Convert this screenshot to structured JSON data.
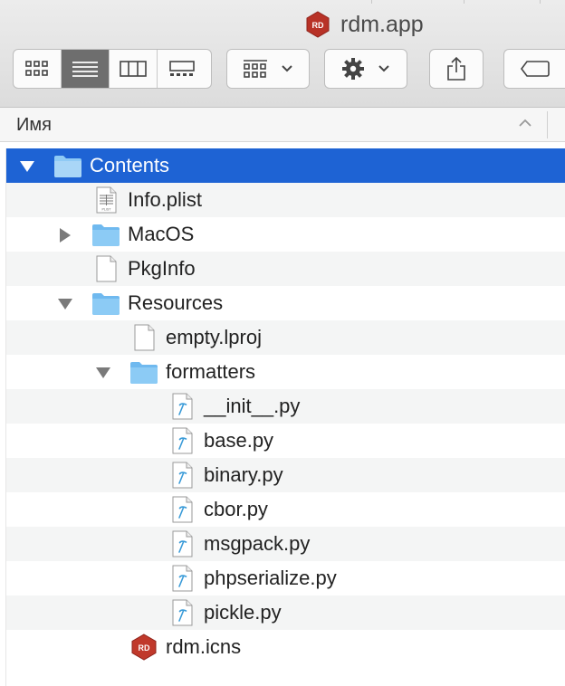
{
  "window": {
    "title": "rdm.app"
  },
  "toolbar": {
    "view_modes": [
      "icon-view",
      "list-view",
      "column-view",
      "gallery-view"
    ],
    "active_view": "list-view"
  },
  "column_header": {
    "name": "Имя"
  },
  "colors": {
    "selection": "#1e63d4",
    "folder": "#6fb9ef",
    "script_accent": "#3a9bd8",
    "app_icon": "#c0392b"
  },
  "files": [
    {
      "label": "Contents",
      "type": "folder",
      "depth": 0,
      "disclosure": "expanded",
      "selected": true
    },
    {
      "label": "Info.plist",
      "type": "plist",
      "depth": 1,
      "disclosure": "none",
      "selected": false
    },
    {
      "label": "MacOS",
      "type": "folder",
      "depth": 1,
      "disclosure": "collapsed",
      "selected": false
    },
    {
      "label": "PkgInfo",
      "type": "document",
      "depth": 1,
      "disclosure": "none",
      "selected": false
    },
    {
      "label": "Resources",
      "type": "folder",
      "depth": 1,
      "disclosure": "expanded",
      "selected": false
    },
    {
      "label": "empty.lproj",
      "type": "document",
      "depth": 2,
      "disclosure": "none",
      "selected": false
    },
    {
      "label": "formatters",
      "type": "folder",
      "depth": 2,
      "disclosure": "expanded",
      "selected": false
    },
    {
      "label": "__init__.py",
      "type": "python",
      "depth": 3,
      "disclosure": "none",
      "selected": false
    },
    {
      "label": "base.py",
      "type": "python",
      "depth": 3,
      "disclosure": "none",
      "selected": false
    },
    {
      "label": "binary.py",
      "type": "python",
      "depth": 3,
      "disclosure": "none",
      "selected": false
    },
    {
      "label": "cbor.py",
      "type": "python",
      "depth": 3,
      "disclosure": "none",
      "selected": false
    },
    {
      "label": "msgpack.py",
      "type": "python",
      "depth": 3,
      "disclosure": "none",
      "selected": false
    },
    {
      "label": "phpserialize.py",
      "type": "python",
      "depth": 3,
      "disclosure": "none",
      "selected": false
    },
    {
      "label": "pickle.py",
      "type": "python",
      "depth": 3,
      "disclosure": "none",
      "selected": false
    },
    {
      "label": "rdm.icns",
      "type": "app-icon",
      "depth": 2,
      "disclosure": "none",
      "selected": false
    }
  ]
}
